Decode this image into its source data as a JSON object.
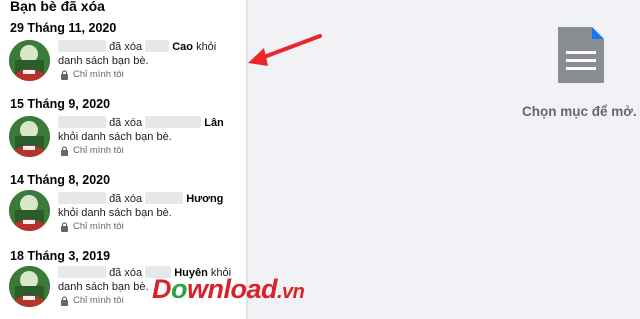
{
  "panel": {
    "title": "Bạn bè đã xóa"
  },
  "entries": [
    {
      "date": "29 Tháng 11, 2020",
      "deleted_verb": "đã xóa",
      "name_fragment": "Cao",
      "suffix": "khỏi danh sách bạn bè.",
      "privacy": "Chỉ mình tôi"
    },
    {
      "date": "15 Tháng 9, 2020",
      "deleted_verb": "đã xóa",
      "name_fragment": "Lân",
      "suffix": "khỏi danh sách bạn bè.",
      "privacy": "Chỉ mình tôi"
    },
    {
      "date": "14 Tháng 8, 2020",
      "deleted_verb": "đã xóa",
      "name_fragment": "Hương",
      "suffix": "khỏi danh sách bạn bè.",
      "privacy": "Chỉ mình tôi"
    },
    {
      "date": "18 Tháng 3, 2019",
      "deleted_verb": "đã xóa",
      "name_fragment": "Huyên",
      "suffix": "khỏi danh sách bạn bè.",
      "privacy": "Chỉ mình tôi"
    }
  ],
  "empty_state": {
    "icon": "document-icon",
    "message": "Chọn mục để mở."
  },
  "annotation": {
    "icon": "red-arrow-icon",
    "color": "#e8262b"
  },
  "watermark": {
    "text": "Download.vn"
  }
}
